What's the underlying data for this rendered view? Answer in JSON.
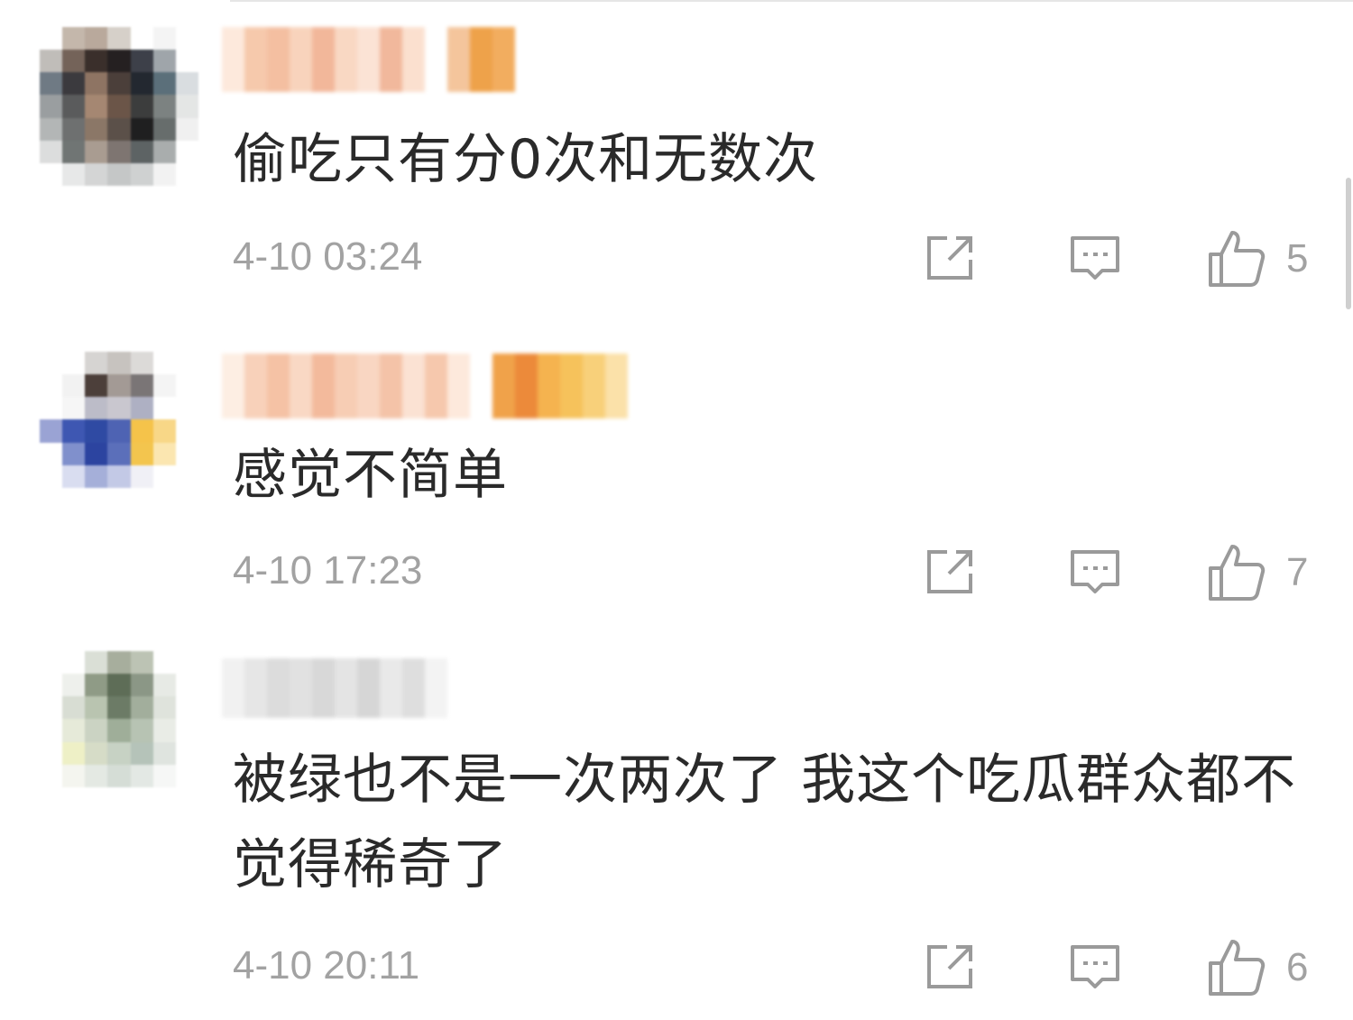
{
  "comments": [
    {
      "content": "偷吃只有分0次和无数次",
      "time": "4-10 03:24",
      "likes": "5",
      "avatar_colors": [
        "#ffffff",
        "#c4b7ab",
        "#b9a99c",
        "#d6d0c9",
        "#ffffff",
        "#f4f4f4",
        "#ffffff",
        "#c0bdb9",
        "#746359",
        "#3a2f2b",
        "#252021",
        "#3d4049",
        "#9fa5aa",
        "#ffffff",
        "#6f7a84",
        "#3b3a3e",
        "#8e7463",
        "#4b3f3a",
        "#232830",
        "#5b6f7a",
        "#d9dde0",
        "#9a9ea0",
        "#5a5b5c",
        "#a58772",
        "#6b5548",
        "#3c3d3d",
        "#7c8281",
        "#e4e6e5",
        "#b3b6b6",
        "#6e7070",
        "#8b7767",
        "#5b5049",
        "#1f1f20",
        "#676d6c",
        "#f0f0f0",
        "#dcdddd",
        "#707574",
        "#a99c91",
        "#7e7571",
        "#5d6364",
        "#a9adad",
        "#ffffff",
        "#ffffff",
        "#e7e8e8",
        "#d4d5d5",
        "#c5c7c7",
        "#cfd1d1",
        "#f2f2f2",
        "#ffffff"
      ],
      "name_colors": [
        "#fde9dc",
        "#f6c9ac",
        "#f4bfa1",
        "#f8d3bc",
        "#f2b79a",
        "#f9d8c3",
        "#fbe3d5",
        "#f1b89c",
        "#fbe0cf",
        "#ffffff",
        "#f4c59c",
        "#eea24a",
        "#f2ad5f"
      ]
    },
    {
      "content": "感觉不简单",
      "time": "4-10 17:23",
      "likes": "7",
      "avatar_colors": [
        "#ffffff",
        "#ffffff",
        "#d6d4d2",
        "#c7c3bf",
        "#dcdad8",
        "#ffffff",
        "#ffffff",
        "#ffffff",
        "#f2f2f2",
        "#4c3f3a",
        "#a39a95",
        "#7a7576",
        "#f4f4f4",
        "#ffffff",
        "#ffffff",
        "#f6f6f6",
        "#bcbcc8",
        "#c9c7cf",
        "#aeb0c3",
        "#ffffff",
        "#ffffff",
        "#9aa3d4",
        "#3e57b2",
        "#2f4aa3",
        "#4e63b3",
        "#f5c34a",
        "#f8d787",
        "#ffffff",
        "#ffffff",
        "#8090cc",
        "#2c44a0",
        "#5b6fba",
        "#f3c54e",
        "#fbe6b0",
        "#ffffff",
        "#ffffff",
        "#d9ddf0",
        "#a5afd9",
        "#c3c9e6",
        "#f0f0f6",
        "#ffffff",
        "#ffffff",
        "#ffffff",
        "#ffffff",
        "#ffffff",
        "#ffffff",
        "#ffffff",
        "#ffffff",
        "#ffffff"
      ],
      "name_colors": [
        "#fdeee3",
        "#f8d1ba",
        "#f5c2a5",
        "#f9d8c4",
        "#f3ba9c",
        "#f7cdb4",
        "#f9d6c2",
        "#f4c3a8",
        "#fbe2d3",
        "#f6c8ad",
        "#fde9dc",
        "#ffffff",
        "#f0a24a",
        "#ec8a3a",
        "#f5b34f",
        "#f6c25b",
        "#f8d07a",
        "#fbe1a9"
      ]
    },
    {
      "content": "被绿也不是一次两次了 我这个吃瓜群众都不觉得稀奇了",
      "time": "4-10 20:11",
      "likes": "6",
      "avatar_colors": [
        "#ffffff",
        "#ffffff",
        "#dadfd6",
        "#a7ae9d",
        "#bcc3b4",
        "#ffffff",
        "#ffffff",
        "#ffffff",
        "#eef0ec",
        "#8f9b86",
        "#5e6d57",
        "#8b9786",
        "#e7eae5",
        "#ffffff",
        "#ffffff",
        "#d8ddd3",
        "#b9c4b0",
        "#6c7b66",
        "#a2ae9c",
        "#dfe3dc",
        "#ffffff",
        "#ffffff",
        "#e6ead9",
        "#cbd3c3",
        "#9fae99",
        "#b7c3b3",
        "#e9ece6",
        "#ffffff",
        "#ffffff",
        "#eef0c6",
        "#d6dcc7",
        "#c7d2c4",
        "#b5c3b9",
        "#dfe4df",
        "#ffffff",
        "#ffffff",
        "#f4f5ef",
        "#e4e9e3",
        "#d5ddd6",
        "#e3e8e4",
        "#f6f7f6",
        "#ffffff",
        "#ffffff",
        "#ffffff",
        "#ffffff",
        "#ffffff",
        "#ffffff",
        "#ffffff",
        "#ffffff"
      ],
      "name_colors": [
        "#f1f1f1",
        "#e6e6e6",
        "#dcdcdc",
        "#e1e1e1",
        "#d8d8d8",
        "#e4e4e4",
        "#d6d6d6",
        "#e9e9e9",
        "#dedede",
        "#f3f3f3"
      ]
    }
  ],
  "icons": {
    "share": "share-icon",
    "reply": "comment-icon",
    "like": "thumbs-up-icon"
  },
  "colors": {
    "text": "#2a2a2a",
    "meta": "#a2a2a2",
    "icon": "#9a9a9a"
  }
}
